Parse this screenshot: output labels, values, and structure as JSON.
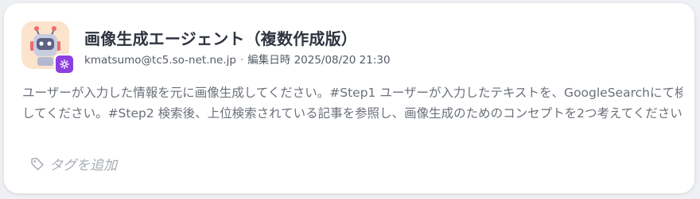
{
  "agent": {
    "title": "画像生成エージェント（複数作成版）",
    "author": "kmatsumo@tc5.so-net.ne.jp",
    "separator": "·",
    "edited_label": "編集日時",
    "edited_at": "2025/08/20 21:30",
    "description_line1": "ユーザーが入力した情報を元に画像生成してください。#Step1 ユーザーが入力したテキストを、GoogleSearchにて検索",
    "description_line2": "してください。#Step2 検索後、上位検索されている記事を参照し、画像生成のためのコンセプトを2つ考えてください...",
    "add_tag_label": "タグを追加"
  },
  "icons": {
    "avatar": "robot-icon",
    "badge": "gear-icon",
    "tag": "tag-icon"
  },
  "colors": {
    "card_background": "#ffffff",
    "avatar_background": "#fbe3cc",
    "badge": "#8b3fe0",
    "title": "#2f3440",
    "description": "#6b7079",
    "tag_placeholder": "#a6abb3"
  }
}
